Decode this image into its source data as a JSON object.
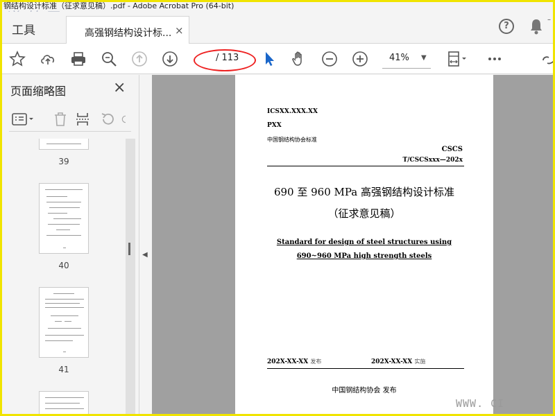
{
  "window": {
    "title": "钢结构设计标准（征求意见稿）.pdf - Adobe Acrobat Pro (64-bit)",
    "watermark": "道 林 网"
  },
  "tabs": {
    "tools_label": "工具",
    "doc_label": "高强钢结构设计标...",
    "close_glyph": "×"
  },
  "toolbar": {
    "page_input": "",
    "page_total": "/ 113",
    "zoom_value": "41%"
  },
  "panel": {
    "title": "页面缩略图",
    "close_glyph": "×",
    "thumbs": [
      {
        "num": "39"
      },
      {
        "num": "40"
      },
      {
        "num": "41"
      }
    ]
  },
  "document": {
    "ics": "ICSXX.XXX.XX",
    "pxx": "PXX",
    "assoc_std": "中国钢结构协会标准",
    "cscs": "CSCS",
    "std_no": "T/CSCSxxx—202x",
    "title_cn": "690 至 960 MPa 高强钢结构设计标准",
    "subtitle_cn": "（征求意见稿）",
    "title_en_1": "Standard for design of steel structures using",
    "title_en_2": "690~960 MPa high strength steels",
    "issue_date": "202X-XX-XX",
    "issue_label": "发布",
    "impl_date": "202X-XX-XX",
    "impl_label": "实施",
    "publisher": "中国钢结构协会  发布"
  },
  "site_watermark": "WWW. CI",
  "colors": {
    "accent_blue": "#1a66c9",
    "annotation_red": "#e02020",
    "frame_yellow": "#f0e400"
  }
}
